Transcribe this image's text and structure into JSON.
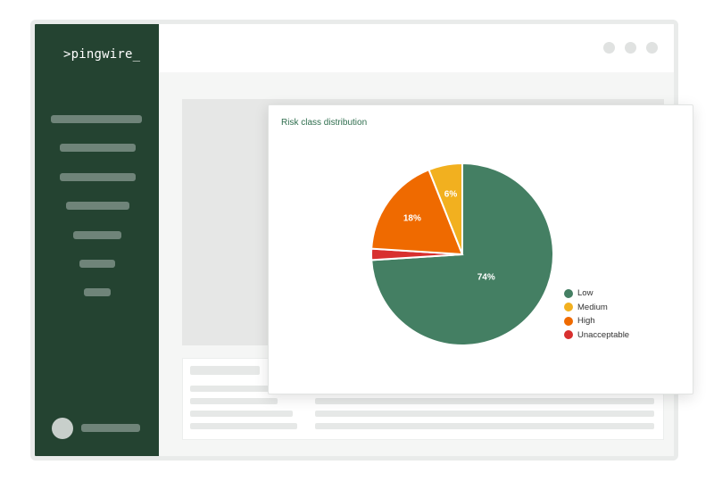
{
  "app": {
    "brand": ">pingwire_"
  },
  "colors": {
    "sidebar": "#244331",
    "accent": "#2f6e4e"
  },
  "icons": {
    "user": "avatar-icon",
    "window_controls": "window-dot-icon"
  },
  "card": {
    "title": "Risk class distribution"
  },
  "chart_data": {
    "type": "pie",
    "title": "Risk class distribution",
    "categories": [
      "Low",
      "Medium",
      "High",
      "Unacceptable"
    ],
    "values": [
      74,
      6,
      18,
      2
    ],
    "slice_labels": [
      "74%",
      "6%",
      "18%",
      ""
    ],
    "slice_order_clockwise_from_top": [
      "Low",
      "Unacceptable",
      "High",
      "Medium"
    ],
    "colors": {
      "Low": "#447f63",
      "Medium": "#f2b01f",
      "High": "#ef6a00",
      "Unacceptable": "#d8302f"
    },
    "legend_position": "right",
    "legend": [
      "Low",
      "Medium",
      "High",
      "Unacceptable"
    ]
  }
}
